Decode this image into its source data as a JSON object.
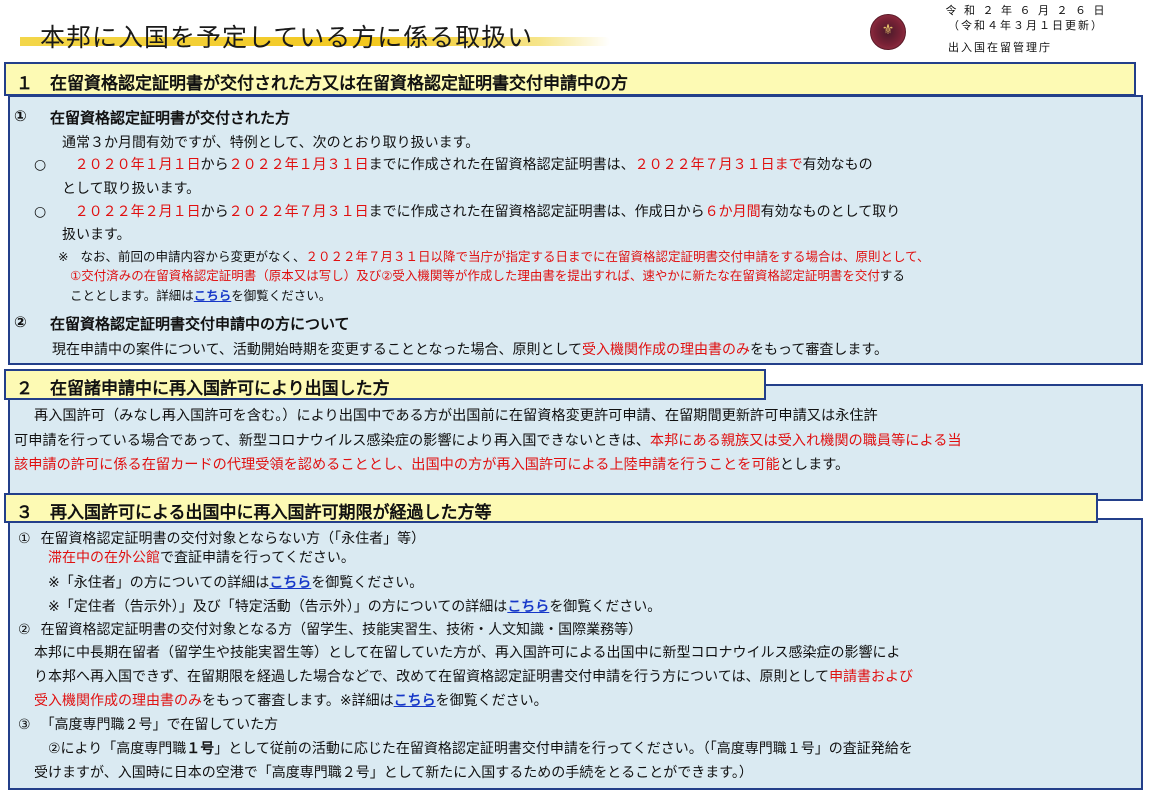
{
  "header": {
    "title": "本邦に入国を予定している方に係る取扱い",
    "date_line1": "令 和 ２ 年 ６ 月 ２ ６ 日",
    "date_line2": "（令和４年３月１日更新）",
    "agency": "出入国在留管理庁",
    "emblem_icon": "immigration-emblem-icon",
    "accent_color": "#f3c81f"
  },
  "section1": {
    "heading": "１　在留資格認定証明書が交付された方又は在留資格認定証明書交付申請中の方",
    "item1": {
      "marker": "①",
      "title": "在留資格認定証明書が交付された方",
      "intro": "通常３か月間有効ですが、特例として、次のとおり取り扱います。",
      "b1_marker": "○",
      "b1_red1": "２０２０年１月１日",
      "b1_t1": "から",
      "b1_red2": "２０２２年１月３１日",
      "b1_t2": "までに作成された在留資格認定証明書は、",
      "b1_red3": "２０２２年７月３１日まで",
      "b1_t3": "有効なもの",
      "b1_line2": "として取り扱います。",
      "b2_marker": "○",
      "b2_red1": "２０２２年２月１日",
      "b2_t1": "から",
      "b2_red2": "２０２２年７月３１日",
      "b2_t2": "までに作成された在留資格認定証明書は、作成日から",
      "b2_red3": "６か月間",
      "b2_t3": "有効なものとして取り",
      "b2_line2": "扱います。",
      "note_marker": "※",
      "note_t1": "なお、前回の申請内容から変更がなく、",
      "note_red1": "２０２２年７月３１日以降で当庁が指定する日までに在留資格認定証明書交付申請をする場合は、原則として、",
      "note_red2": "①交付済みの在留資格認定証明書（原本又は写し）及び②受入機関等が作成した理由書を提出すれば、速やかに新たな在留資格認定証明書を交付",
      "note_t2": "する",
      "note_t3": "こととします。詳細は",
      "note_link": "こちら",
      "note_t4": "を御覧ください。"
    },
    "item2": {
      "marker": "②",
      "title": "在留資格認定証明書交付申請中の方について",
      "t1": "現在申請中の案件について、活動開始時期を変更することとなった場合、原則として",
      "red1": "受入機関作成の理由書のみ",
      "t2": "をもって審査します。"
    }
  },
  "section2": {
    "heading": "２　在留諸申請中に再入国許可により出国した方",
    "l1": "再入国許可（みなし再入国許可を含む。）により出国中である方が出国前に在留資格変更許可申請、在留期間更新許可申請又は永住許",
    "l2_t1": "可申請を行っている場合であって、新型コロナウイルス感染症の影響により再入国できないときは、",
    "l2_red": "本邦にある親族又は受入れ機関の職員等による当",
    "l3_red": "該申請の許可に係る在留カードの代理受領を認めることとし、出国中の方が再入国許可による上陸申請を行うことを可能",
    "l3_t": "とします。"
  },
  "section3": {
    "heading": "３　再入国許可による出国中に再入国許可期限が経過した方等",
    "i1_marker": "①",
    "i1_title": "在留資格認定証明書の交付対象とならない方（「永住者」等）",
    "i1_red": "滞在中の在外公館",
    "i1_t": "で査証申請を行ってください。",
    "i1_n1_t1": "※「永住者」の方についての詳細は",
    "i1_n1_link": "こちら",
    "i1_n1_t2": "を御覧ください。",
    "i1_n2_t1": "※「定住者（告示外）」及び「特定活動（告示外）」の方についての詳細は",
    "i1_n2_link": "こちら",
    "i1_n2_t2": "を御覧ください。",
    "i2_marker": "②",
    "i2_title": "在留資格認定証明書の交付対象となる方（留学生、技能実習生、技術・人文知識・国際業務等）",
    "i2_l1": "本邦に中長期在留者（留学生や技能実習生等）として在留していた方が、再入国許可による出国中に新型コロナウイルス感染症の影響によ",
    "i2_l2_t1": "り本邦へ再入国できず、在留期限を経過した場合などで、改めて在留資格認定証明書交付申請を行う方については、原則として",
    "i2_l2_red": "申請書および",
    "i2_l3_red": "受入機関作成の理由書のみ",
    "i2_l3_t1": "をもって審査します。※詳細は",
    "i2_l3_link": "こちら",
    "i2_l3_t2": "を御覧ください。",
    "i3_marker": "③",
    "i3_title": "「高度専門職２号」で在留していた方",
    "i3_l1_t1": "②により「高度専門職",
    "i3_l1_b": "１号",
    "i3_l1_t2": "」として従前の活動に応じた在留資格認定証明書交付申請を行ってください。（「高度専門職１号」の査証発給を",
    "i3_l2": "受けますが、入国時に日本の空港で「高度専門職２号」として新たに入国するための手続をとることができます。）"
  }
}
